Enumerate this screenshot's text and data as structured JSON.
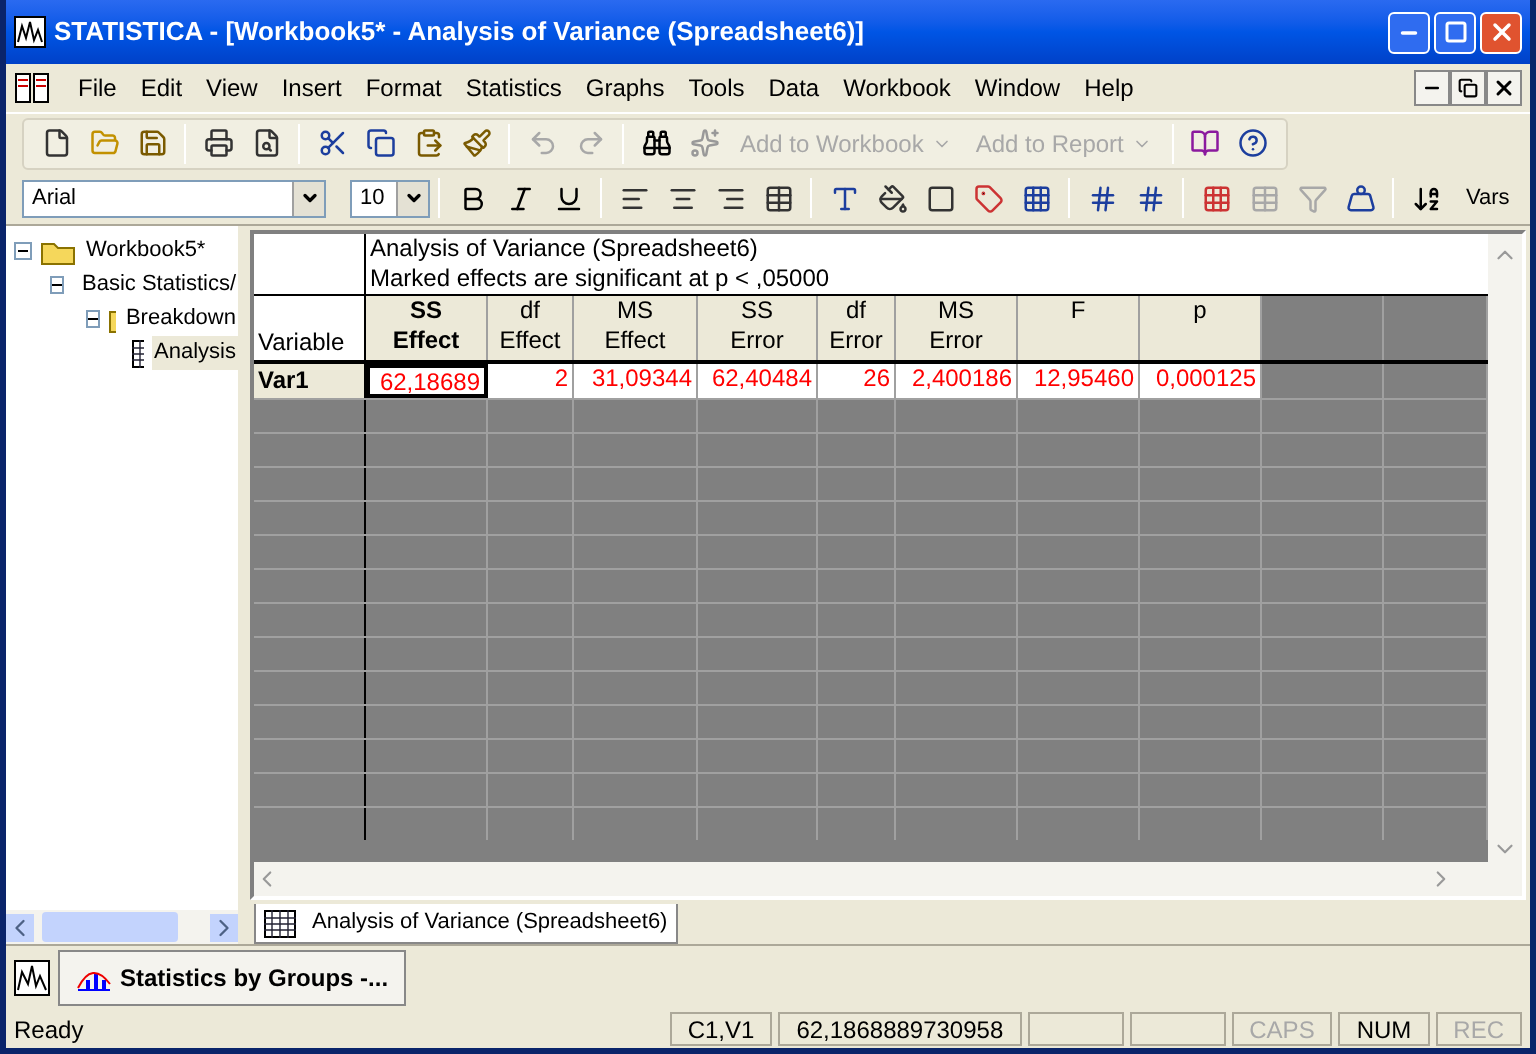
{
  "window": {
    "title": "STATISTICA - [Workbook5* - Analysis of Variance (Spreadsheet6)]"
  },
  "menu": [
    "File",
    "Edit",
    "View",
    "Insert",
    "Format",
    "Statistics",
    "Graphs",
    "Tools",
    "Data",
    "Workbook",
    "Window",
    "Help"
  ],
  "toolbar": {
    "add_to_workbook": {
      "label": "Add to Workbook",
      "disabled": true
    },
    "add_to_report": {
      "label": "Add to Report",
      "disabled": true
    }
  },
  "format_bar": {
    "font": "Arial",
    "size": "10",
    "vars": "Vars"
  },
  "tree": [
    {
      "label": "Workbook5*",
      "expanded": true,
      "children": [
        {
          "label": "Basic Statistics/",
          "expanded": true,
          "children": [
            {
              "label": "Breakdown",
              "expanded": true,
              "children": [
                {
                  "label": "Analysis",
                  "selected": true
                }
              ]
            }
          ]
        }
      ]
    }
  ],
  "sheet": {
    "title": "Analysis of Variance (Spreadsheet6)",
    "subtitle": "Marked effects are significant at p < ,05000",
    "row_header": "Variable",
    "columns": [
      {
        "line1": "SS",
        "line2": "Effect",
        "bold": true
      },
      {
        "line1": "df",
        "line2": "Effect",
        "bold": false
      },
      {
        "line1": "MS",
        "line2": "Effect",
        "bold": false
      },
      {
        "line1": "SS",
        "line2": "Error",
        "bold": false
      },
      {
        "line1": "df",
        "line2": "Error",
        "bold": false
      },
      {
        "line1": "MS",
        "line2": "Error",
        "bold": false
      },
      {
        "line1": "F",
        "bold": false
      },
      {
        "line1": "p",
        "bold": false
      }
    ],
    "rows": [
      {
        "name": "Var1",
        "marked": true,
        "cells": [
          {
            "value": "62,18689",
            "marked": true,
            "selected": true
          },
          {
            "value": "2",
            "marked": true,
            "selected": false
          },
          {
            "value": "31,09344",
            "marked": true,
            "selected": false
          },
          {
            "value": "62,40484",
            "marked": true,
            "selected": false
          },
          {
            "value": "26",
            "marked": true,
            "selected": false
          },
          {
            "value": "2,400186",
            "marked": true,
            "selected": false
          },
          {
            "value": "12,95460",
            "marked": true,
            "selected": false
          },
          {
            "value": "0,000125",
            "marked": true,
            "selected": false
          }
        ]
      }
    ]
  },
  "sheet_tab": {
    "label": "Analysis of Variance (Spreadsheet6)"
  },
  "taskbar": {
    "item": "Statistics by Groups -..."
  },
  "status_bar": [
    {
      "text": "Ready",
      "kind": "message"
    },
    {
      "text": "C1,V1",
      "kind": "panel",
      "disabled": false
    },
    {
      "text": "62,1868889730958",
      "kind": "panel",
      "disabled": false
    },
    {
      "kind": "blank"
    },
    {
      "kind": "blank"
    },
    {
      "text": "CAPS",
      "kind": "panel",
      "disabled": true
    },
    {
      "text": "NUM",
      "kind": "panel",
      "disabled": false
    },
    {
      "text": "REC",
      "kind": "panel",
      "disabled": true
    }
  ]
}
